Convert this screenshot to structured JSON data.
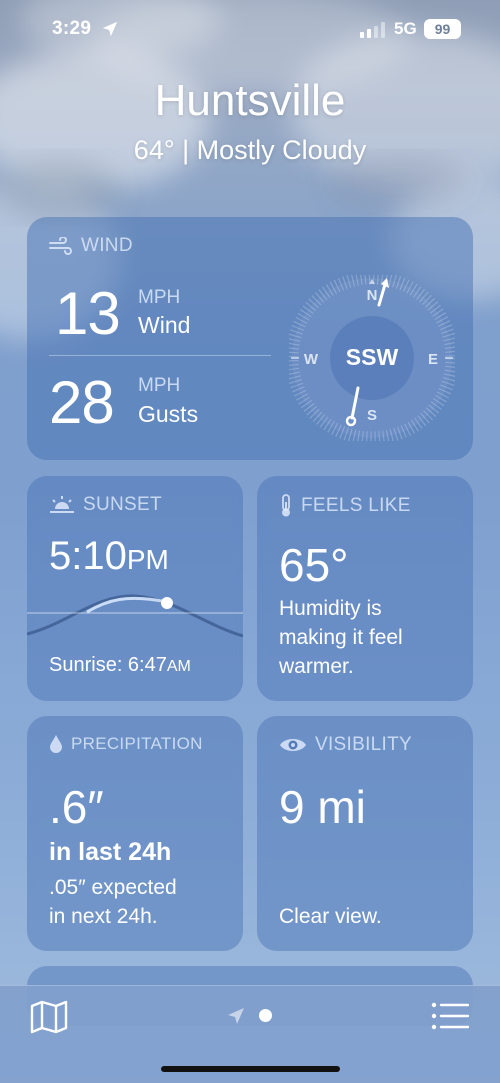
{
  "status_bar": {
    "time": "3:29",
    "network": "5G",
    "battery": "99"
  },
  "header": {
    "city": "Huntsville",
    "temp_condition": "64° | Mostly Cloudy"
  },
  "wind": {
    "title": "WIND",
    "wind_speed": "13",
    "wind_unit": "MPH",
    "wind_label": "Wind",
    "gust_speed": "28",
    "gust_unit": "MPH",
    "gust_label": "Gusts",
    "direction": "SSW",
    "compass_n": "N",
    "compass_s": "S",
    "compass_e": "E",
    "compass_w": "W"
  },
  "sunset": {
    "title": "SUNSET",
    "time": "5:10",
    "time_suffix": "PM",
    "sunrise_label": "Sunrise: 6:47",
    "sunrise_suffix": "AM"
  },
  "feels_like": {
    "title": "FEELS LIKE",
    "value": "65°",
    "description_line1": "Humidity is",
    "description_line2": "making it feel",
    "description_line3": "warmer."
  },
  "precipitation": {
    "title": "PRECIPITATION",
    "amount": ".6″",
    "period": "in last 24h",
    "forecast_line1": ".05″ expected",
    "forecast_line2": "in next 24h."
  },
  "visibility": {
    "title": "VISIBILITY",
    "value": "9 mi",
    "description": "Clear view."
  },
  "colors": {
    "card_bg": "#4670b4",
    "sky_top": "#8f9eb6",
    "sky_bottom": "#9fb9dc"
  },
  "icons": {
    "status": [
      "location-arrow-icon",
      "signal-bars-icon"
    ],
    "cards": [
      "wind-icon",
      "sunset-icon",
      "thermometer-icon",
      "raindrop-icon",
      "eye-icon"
    ],
    "tabbar": [
      "map-icon",
      "location-arrow-icon",
      "list-icon"
    ]
  }
}
